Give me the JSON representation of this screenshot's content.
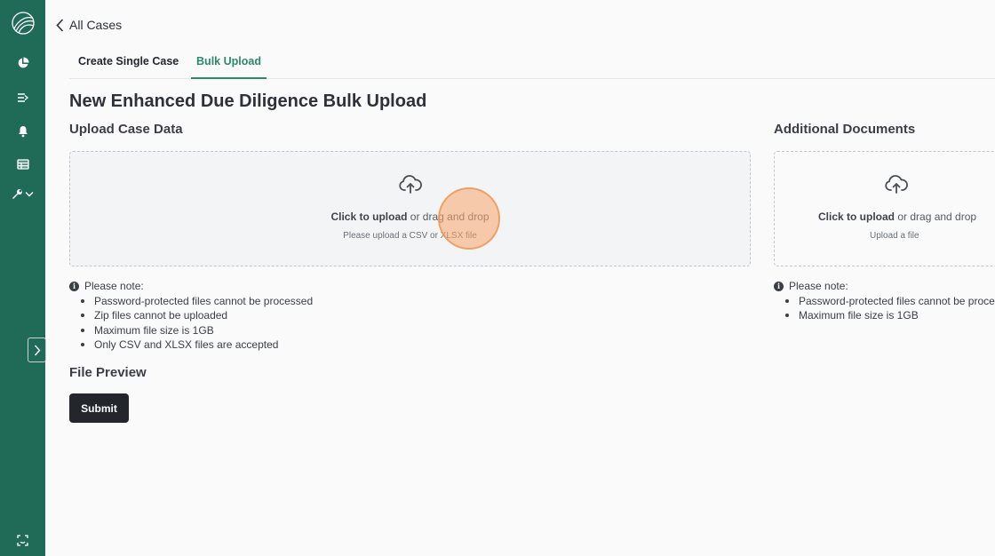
{
  "nav": {
    "back_label": "All Cases"
  },
  "tabs": [
    {
      "label": "Create Single Case",
      "active": false
    },
    {
      "label": "Bulk Upload",
      "active": true
    }
  ],
  "page": {
    "title": "New Enhanced Due Diligence Bulk Upload",
    "file_preview_title": "File Preview",
    "submit_label": "Submit"
  },
  "upload_case": {
    "title": "Upload Case Data",
    "click_label": "Click to upload",
    "drag_label": " or drag and drop",
    "hint": "Please upload a CSV or XLSX file",
    "note_heading": "Please note:",
    "notes": [
      "Password-protected files cannot be processed",
      "Zip files cannot be uploaded",
      "Maximum file size is 1GB",
      "Only CSV and XLSX files are accepted"
    ]
  },
  "additional_docs": {
    "title": "Additional Documents",
    "click_label": "Click to upload",
    "drag_label": " or drag and drop",
    "hint": "Upload a file",
    "note_heading": "Please note:",
    "notes": [
      "Password-protected files cannot be processed",
      "Maximum file size is 1GB"
    ]
  },
  "colors": {
    "sidebar": "#1f6b58",
    "accent": "#2b8a6a",
    "button": "#23272b"
  }
}
